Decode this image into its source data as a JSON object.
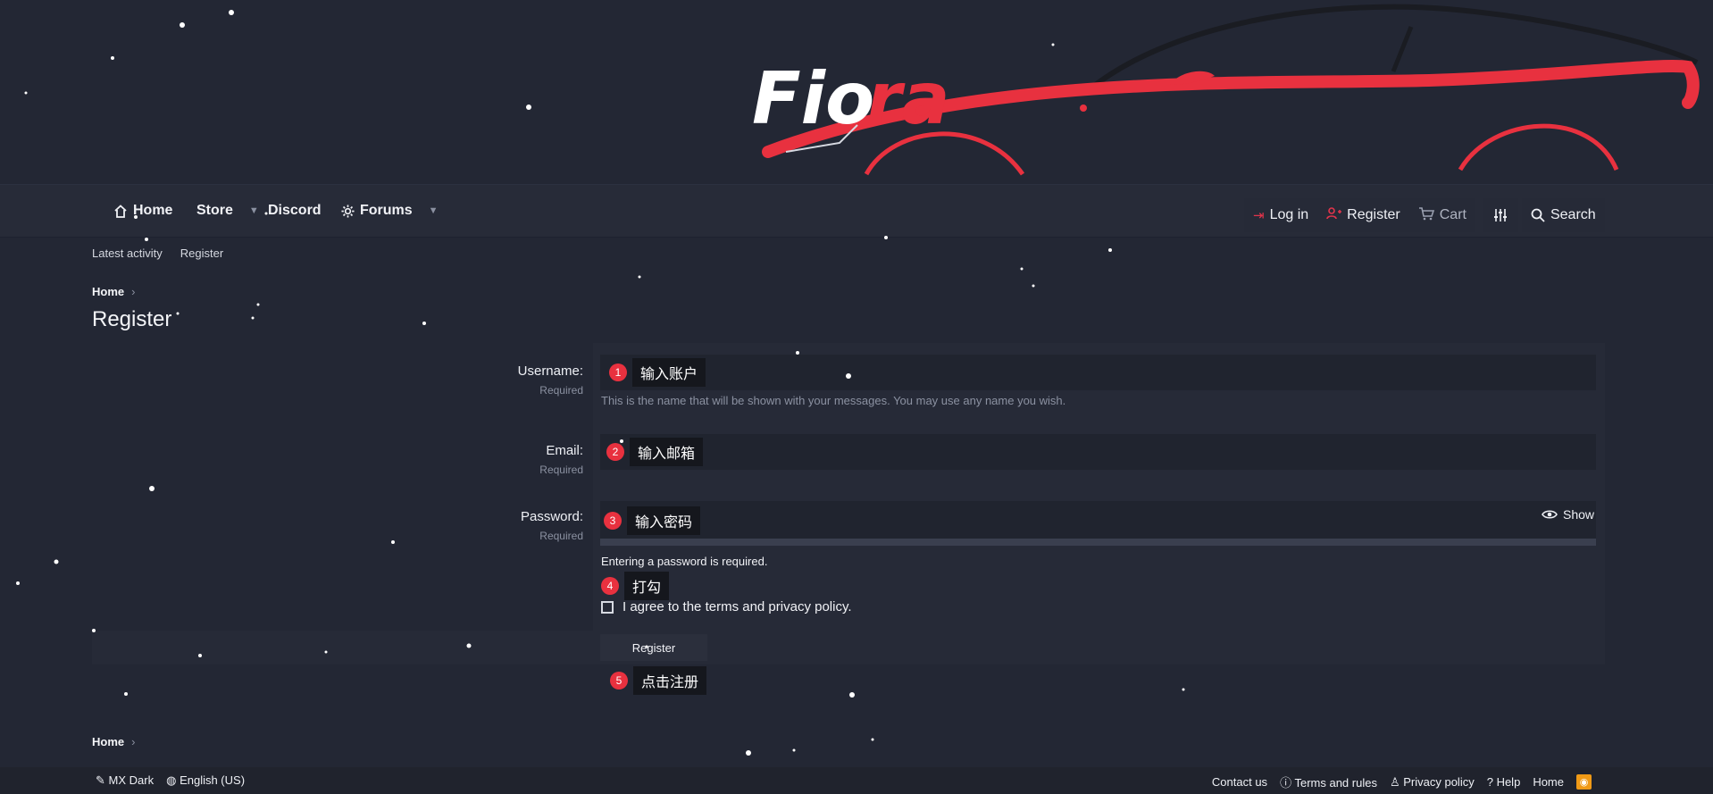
{
  "header": {
    "logo_text_a": "Fio",
    "logo_text_b": "ra",
    "accent_color": "#e8313f"
  },
  "nav": {
    "home": "Home",
    "store": "Store",
    "discord": "Discord",
    "forums": "Forums",
    "login": "Log in",
    "register": "Register",
    "cart": "Cart",
    "search": "Search",
    "icons": {
      "home": "home-icon",
      "forums": "gear-icon",
      "login": "login-icon",
      "register": "user-plus-icon",
      "cart": "cart-icon",
      "style": "sliders-icon",
      "search": "search-icon"
    }
  },
  "subnav": {
    "latest_activity": "Latest activity",
    "register": "Register"
  },
  "breadcrumb": {
    "home": "Home"
  },
  "page": {
    "title": "Register"
  },
  "form": {
    "username_label": "Username:",
    "email_label": "Email:",
    "password_label": "Password:",
    "required": "Required",
    "username_hint": "This is the name that will be shown with your messages. You may use any name you wish.",
    "show_label": "Show",
    "password_required_text": "Entering a password is required.",
    "agree_text": "I agree to the terms and privacy policy.",
    "register_button": "Register"
  },
  "annotations": [
    {
      "num": "1",
      "text": "输入账户"
    },
    {
      "num": "2",
      "text": "输入邮箱"
    },
    {
      "num": "3",
      "text": "输入密码"
    },
    {
      "num": "4",
      "text": "打勾"
    },
    {
      "num": "5",
      "text": "点击注册"
    }
  ],
  "footer": {
    "style": "MX Dark",
    "language": "English (US)",
    "contact": "Contact us",
    "terms": "Terms and rules",
    "privacy": "Privacy policy",
    "help": "Help",
    "home": "Home"
  }
}
